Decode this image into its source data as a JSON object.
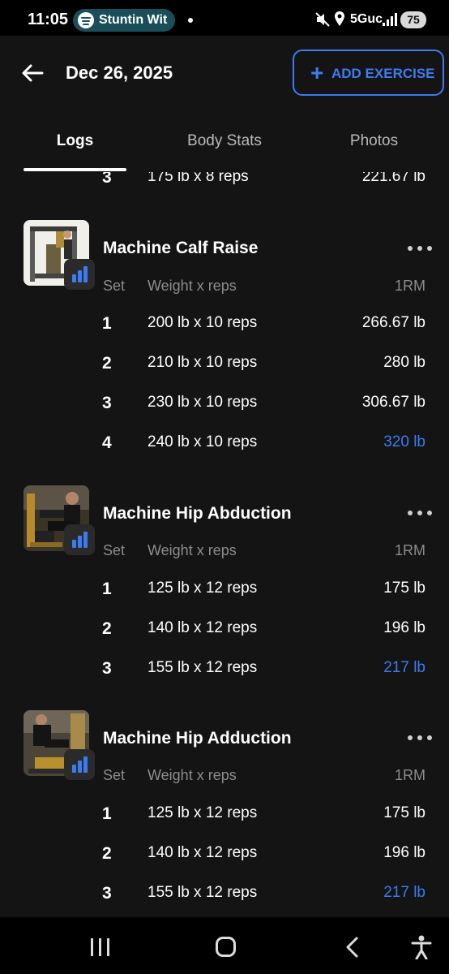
{
  "status_bar": {
    "time": "11:05",
    "media_pill": "Stuntin Wit",
    "network": "5Guc",
    "battery": "75"
  },
  "header": {
    "title": "Dec 26, 2025",
    "add_button": "ADD EXERCISE"
  },
  "tabs": [
    "Logs",
    "Body Stats",
    "Photos"
  ],
  "active_tab": "Logs",
  "accent_color": "#3d7bf0",
  "previous_exercise_tail": {
    "set": "3",
    "weight_reps": "175 lb x 8 reps",
    "one_rm": "221.67 lb"
  },
  "exercises": [
    {
      "name": "Machine Calf Raise",
      "header": {
        "set": "Set",
        "weight_reps": "Weight x reps",
        "one_rm": "1RM"
      },
      "sets": [
        {
          "set": "1",
          "weight_reps": "200 lb x 10 reps",
          "one_rm": "266.67 lb"
        },
        {
          "set": "2",
          "weight_reps": "210 lb x 10 reps",
          "one_rm": "280 lb"
        },
        {
          "set": "3",
          "weight_reps": "230 lb x 10 reps",
          "one_rm": "306.67 lb"
        },
        {
          "set": "4",
          "weight_reps": "240 lb x 10 reps",
          "one_rm": "320 lb"
        }
      ]
    },
    {
      "name": "Machine Hip Abduction",
      "header": {
        "set": "Set",
        "weight_reps": "Weight x reps",
        "one_rm": "1RM"
      },
      "sets": [
        {
          "set": "1",
          "weight_reps": "125 lb x 12 reps",
          "one_rm": "175 lb"
        },
        {
          "set": "2",
          "weight_reps": "140 lb x 12 reps",
          "one_rm": "196 lb"
        },
        {
          "set": "3",
          "weight_reps": "155 lb x 12 reps",
          "one_rm": "217 lb"
        }
      ]
    },
    {
      "name": "Machine Hip Adduction",
      "header": {
        "set": "Set",
        "weight_reps": "Weight x reps",
        "one_rm": "1RM"
      },
      "sets": [
        {
          "set": "1",
          "weight_reps": "125 lb x 12 reps",
          "one_rm": "175 lb"
        },
        {
          "set": "2",
          "weight_reps": "140 lb x 12 reps",
          "one_rm": "196 lb"
        },
        {
          "set": "3",
          "weight_reps": "155 lb x 12 reps",
          "one_rm": "217 lb"
        }
      ]
    }
  ]
}
